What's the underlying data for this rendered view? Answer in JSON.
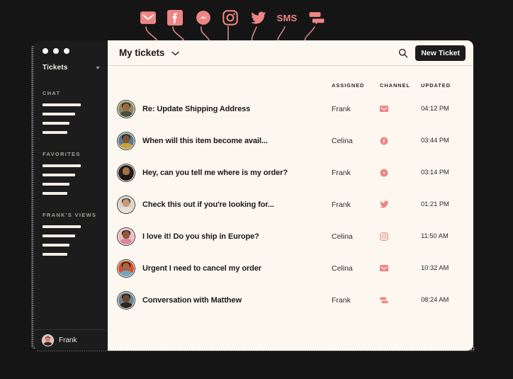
{
  "channel_strip": {
    "icons": [
      {
        "name": "email-icon",
        "label": "Email"
      },
      {
        "name": "facebook-icon",
        "label": "Facebook"
      },
      {
        "name": "messenger-icon",
        "label": "Messenger"
      },
      {
        "name": "instagram-icon",
        "label": "Instagram"
      },
      {
        "name": "twitter-icon",
        "label": "Twitter"
      },
      {
        "name": "sms-icon",
        "label": "SMS"
      },
      {
        "name": "chat-icon",
        "label": "Chat"
      }
    ],
    "accent_color": "#EE8585"
  },
  "sidebar": {
    "workspace": "Tickets",
    "sections": [
      {
        "title": "CHAT",
        "item_widths": [
          54,
          46,
          38,
          35
        ]
      },
      {
        "title": "FAVORITES",
        "item_widths": [
          54,
          46,
          38,
          35
        ]
      },
      {
        "title": "FRANK'S VIEWS",
        "item_widths": [
          54,
          46,
          38,
          35
        ]
      }
    ],
    "footer_user": "Frank"
  },
  "topbar": {
    "view_title": "My tickets",
    "new_ticket_label": "New Ticket"
  },
  "table": {
    "columns": {
      "subject": "",
      "assigned": "ASSIGNED",
      "channel": "CHANNEL",
      "updated": "UPDATED"
    },
    "rows": [
      {
        "subject": "Re: Update Shipping Address",
        "assigned": "Frank",
        "channel": "email-icon",
        "updated": "04:12 PM"
      },
      {
        "subject": "When will this item become avail...",
        "assigned": "Celina",
        "channel": "facebook-icon",
        "updated": "03:44 PM"
      },
      {
        "subject": "Hey, can you tell me where is my order?",
        "assigned": "Frank",
        "channel": "messenger-icon",
        "updated": "03:14 PM"
      },
      {
        "subject": "Check this out if you're looking for...",
        "assigned": "Frank",
        "channel": "twitter-icon",
        "updated": "01:21 PM"
      },
      {
        "subject": "I love it! Do you ship in Europe?",
        "assigned": "Celina",
        "channel": "instagram-icon",
        "updated": "11:50 AM"
      },
      {
        "subject": "Urgent I need to cancel my order",
        "assigned": "Celina",
        "channel": "email-icon",
        "updated": "10:32 AM"
      },
      {
        "subject": "Conversation with Matthew",
        "assigned": "Frank",
        "channel": "chat-icon",
        "updated": "08:24 AM"
      }
    ]
  },
  "colors": {
    "page_background": "#151515",
    "panel_background": "#FDF8EF",
    "sidebar_background": "#1C1C1C",
    "accent": "#EE8585",
    "text_dark": "#1A1A1A"
  }
}
